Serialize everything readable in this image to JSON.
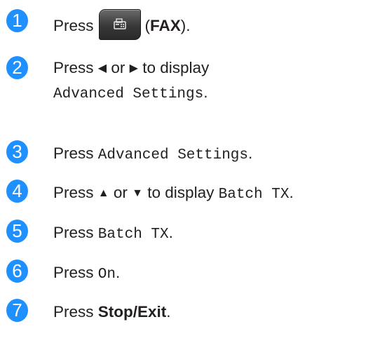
{
  "steps": [
    {
      "number": "1",
      "press": "Press",
      "open_paren": "(",
      "fax_label": "FAX",
      "close_paren": ").",
      "icon": "fax-icon"
    },
    {
      "number": "2",
      "press": "Press",
      "left_arrow": "◀",
      "or": "or",
      "right_arrow": "▶",
      "to_display": "to display",
      "setting": "Advanced Settings",
      "period": "."
    },
    {
      "number": "3",
      "press": "Press",
      "setting": "Advanced Settings",
      "period": "."
    },
    {
      "number": "4",
      "press": "Press",
      "up_arrow": "▲",
      "or": "or",
      "down_arrow": "▼",
      "to_display": "to display",
      "setting": "Batch TX",
      "period": "."
    },
    {
      "number": "5",
      "press": "Press",
      "setting": "Batch TX",
      "period": "."
    },
    {
      "number": "6",
      "press": "Press",
      "setting": "On",
      "period": "."
    },
    {
      "number": "7",
      "press": "Press",
      "key": "Stop/Exit",
      "period": "."
    }
  ],
  "colors": {
    "badge": "#1e90ff",
    "text": "#231f20",
    "button": "#3a3a3a"
  }
}
